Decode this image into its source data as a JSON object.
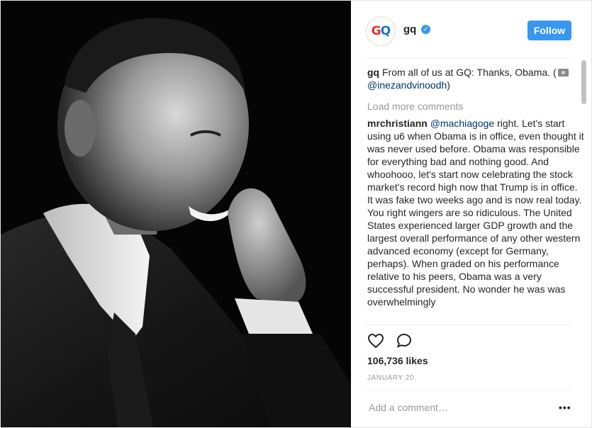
{
  "post": {
    "photo_alt": "Barack Obama portrait",
    "image_style": "black-and-white"
  },
  "header": {
    "avatar_letters": "GQ",
    "username": "gq",
    "verified_icon": "check",
    "follow_label": "Follow"
  },
  "caption": {
    "user": "gq",
    "text": "From all of us at GQ: Thanks, Obama. (",
    "camera_icon": "camera-icon",
    "mention": "@inezandvinoodh",
    "close": ")"
  },
  "load_more": "Load more comments",
  "comment": {
    "user": "mrchristiann",
    "mention": "@machiagoge",
    "text": "right. Let's start using u6 when Obama is in office, even thought it was never used before. Obama was responsible for everything bad and nothing good. And whoohooo, let's start now celebrating the stock market's record high now that Trump is in office. It was fake two weeks ago and is now real today. You right wingers are so ridiculous. The United States experienced larger GDP growth and the largest overall performance of any other western advanced economy (except for Germany, perhaps). When graded on his performance relative to his peers, Obama was a very successful president. No wonder he was was overwhelmingly"
  },
  "actions": {
    "like_icon": "heart-icon",
    "comment_icon": "comment-icon"
  },
  "likes": "106,736 likes",
  "date": "JANUARY 20",
  "add_comment_placeholder": "Add a comment…",
  "more_options": "•••",
  "colors": {
    "accent": "#3897f0",
    "text": "#262626",
    "muted": "#999999",
    "mention": "#003569",
    "gq_red": "#e0332f",
    "gq_blue": "#1a73c9"
  }
}
